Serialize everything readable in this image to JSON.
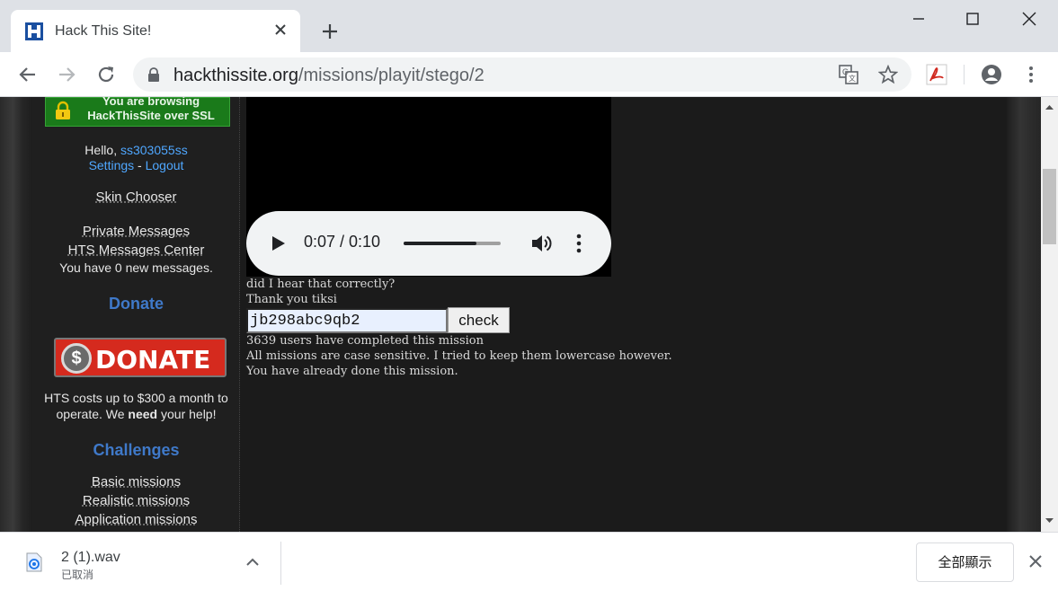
{
  "browser": {
    "tab_title": "Hack This Site!",
    "url_host": "hackthissite.org",
    "url_path": "/missions/playit/stego/2"
  },
  "sidebar": {
    "ssl_line1": "You are browsing",
    "ssl_line2": "HackThisSite over SSL",
    "hello": "Hello, ",
    "username": "ss303055ss",
    "settings": "Settings",
    "dash": " - ",
    "logout": "Logout",
    "skin_chooser": "Skin Chooser",
    "private_messages": "Private Messages",
    "messages_center": "HTS Messages Center",
    "new_messages": "You have 0 new messages.",
    "donate_heading": "Donate",
    "donate_button": "DONATE",
    "donate_coin": "$",
    "cost_line1": "HTS costs up to $300 a month to",
    "cost_line2_a": "operate. We ",
    "cost_line2_b": "need",
    "cost_line2_c": " your help!",
    "challenges_heading": "Challenges",
    "challenges": [
      "Basic missions",
      "Realistic missions",
      "Application missions"
    ]
  },
  "player": {
    "time": "0:07 / 0:10",
    "progress": 0.75
  },
  "mission": {
    "line1": "did I hear that correctly?",
    "line2": "Thank you tiksi",
    "answer_value": "jb298abc9qb2",
    "check_label": "check",
    "completed": "3639 users have completed this mission",
    "case_note": "All missions are case sensitive. I tried to keep them lowercase however.",
    "done_note": "You have already done this mission."
  },
  "downloads": {
    "file_name": "2 (1).wav",
    "status": "已取消",
    "show_all": "全部顯示"
  }
}
